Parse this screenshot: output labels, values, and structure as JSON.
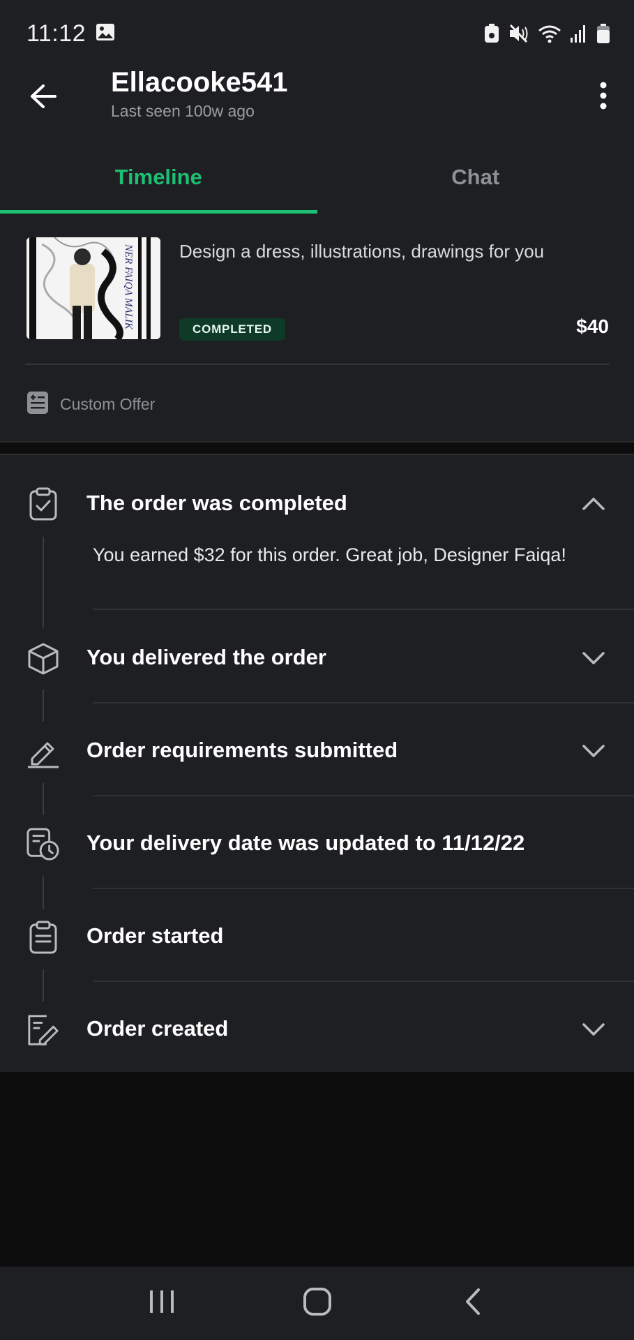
{
  "status_bar": {
    "time": "11:12",
    "icons": [
      "image-icon",
      "battery-saver-icon",
      "mute-icon",
      "wifi-icon",
      "signal-icon",
      "battery-icon"
    ]
  },
  "header": {
    "back_icon": "arrow-left-icon",
    "title": "Ellacooke541",
    "subtitle": "Last seen 100w ago",
    "menu_icon": "more-vertical-icon"
  },
  "tabs": [
    {
      "label": "Timeline",
      "active": true
    },
    {
      "label": "Chat",
      "active": false
    }
  ],
  "order": {
    "title": "Design a dress, illustrations, drawings for you",
    "status": "COMPLETED",
    "price": "$40",
    "offer_type": "Custom Offer",
    "thumbnail_text": "NER FAIQA MALIK"
  },
  "timeline": [
    {
      "title": "The order was completed",
      "icon": "clipboard-check-icon",
      "expandable": true,
      "expanded": true,
      "body": "You earned $32 for this order. Great job, Designer Faiqa!"
    },
    {
      "title": "You delivered the order",
      "icon": "package-icon",
      "expandable": true,
      "expanded": false
    },
    {
      "title": "Order requirements submitted",
      "icon": "pencil-icon",
      "expandable": true,
      "expanded": false
    },
    {
      "title": "Your delivery date was updated to 11/12/22",
      "icon": "calendar-clock-icon",
      "expandable": false,
      "expanded": false
    },
    {
      "title": "Order started",
      "icon": "clipboard-icon",
      "expandable": false,
      "expanded": false
    },
    {
      "title": "Order created",
      "icon": "edit-document-icon",
      "expandable": true,
      "expanded": false
    }
  ],
  "colors": {
    "accent": "#1dbf73",
    "surface": "#1e1f22",
    "background": "#0d0d0e",
    "badge_bg": "#0f3a27"
  },
  "nav": {
    "recent_icon": "recent-apps-icon",
    "home_icon": "home-icon",
    "back_icon": "back-chevron-icon"
  }
}
